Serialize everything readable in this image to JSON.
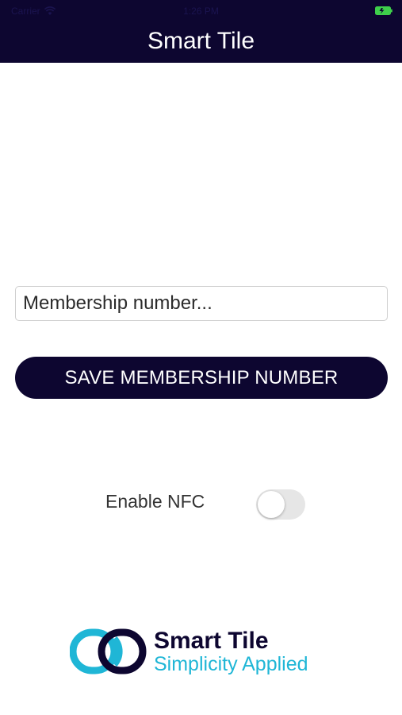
{
  "status_bar": {
    "carrier": "Carrier",
    "time": "1:26 PM"
  },
  "header": {
    "title": "Smart Tile"
  },
  "membership": {
    "placeholder": "Membership number...",
    "value": ""
  },
  "save_button": {
    "label": "SAVE MEMBERSHIP NUMBER"
  },
  "nfc": {
    "label": "Enable NFC",
    "enabled": false
  },
  "logo": {
    "name": "Smart Tile",
    "tagline": "Simplicity Applied"
  },
  "colors": {
    "brand_navy": "#0d0630",
    "brand_cyan": "#1fb6d6",
    "battery_green": "#3ecf4b",
    "toggle_off": "#e6e6e6"
  },
  "icons": [
    "wifi-icon",
    "battery-icon",
    "logo-mark-icon"
  ]
}
